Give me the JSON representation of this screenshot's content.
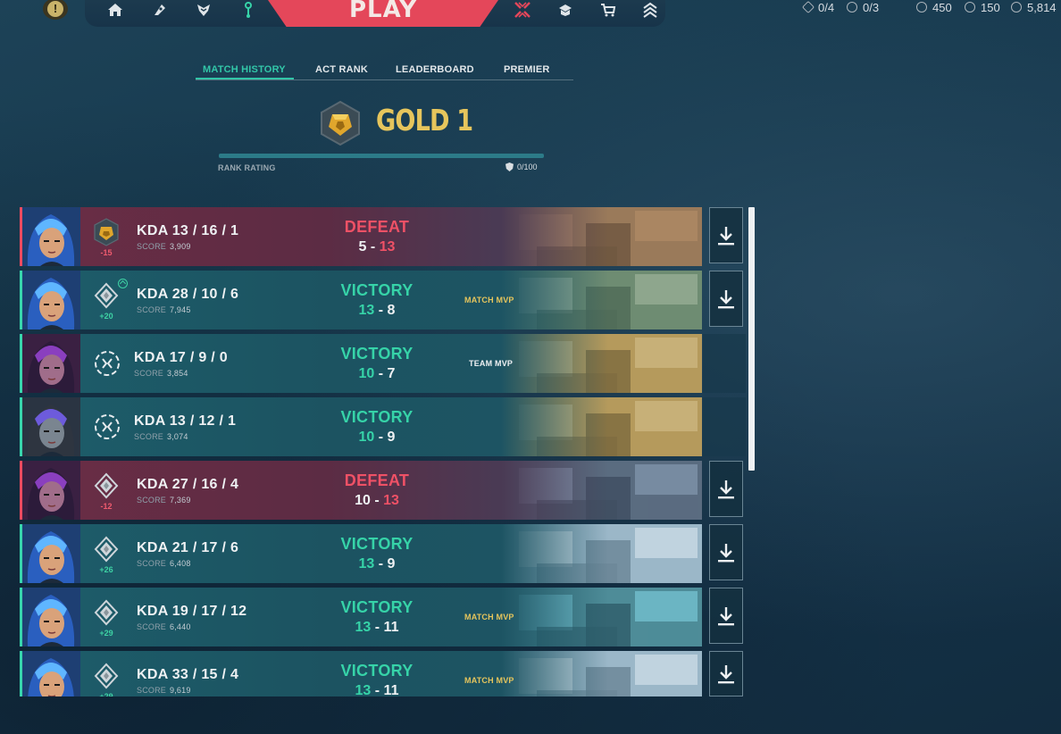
{
  "topbar": {
    "play_label": "PLAY",
    "nav_icons": [
      "home-icon",
      "battlepass-icon",
      "agents-icon",
      "career-icon",
      "crosshair-icon",
      "collection-icon",
      "store-icon",
      "rank-icon"
    ],
    "currencies": [
      {
        "icon": "kingdom-credits-icon",
        "value": "0/4"
      },
      {
        "icon": "free-agent-icon",
        "value": "0/3"
      },
      {
        "icon": "valorant-points-icon",
        "value": "450"
      },
      {
        "icon": "radianite-icon",
        "value": "150"
      },
      {
        "icon": "kingdom-points-icon",
        "value": "5,814"
      }
    ]
  },
  "tabs": [
    {
      "label": "MATCH HISTORY",
      "active": true
    },
    {
      "label": "ACT RANK",
      "active": false
    },
    {
      "label": "LEADERBOARD",
      "active": false
    },
    {
      "label": "PREMIER",
      "active": false
    }
  ],
  "rank": {
    "name": "GOLD 1",
    "rating_label": "RANK RATING",
    "rating_value": "0/100",
    "rating_fraction": 0
  },
  "matches": [
    {
      "result": "DEFEAT",
      "outcome": "loss",
      "kda": "KDA 13 / 16 / 1",
      "score_label": "SCORE",
      "score": "3,909",
      "rr": "-15",
      "rank_badge": "gold",
      "own": "5",
      "sep": " - ",
      "opp": "13",
      "mvp": "",
      "agent": "neon",
      "map": "Bind",
      "download": true
    },
    {
      "result": "VICTORY",
      "outcome": "win",
      "kda": "KDA 28 / 10 / 6",
      "score_label": "SCORE",
      "score": "7,945",
      "rr": "+20",
      "rank_badge": "silver",
      "rank_up": true,
      "own": "13",
      "sep": " - ",
      "opp": "8",
      "mvp": "MATCH MVP",
      "agent": "neon",
      "map": "Sunset",
      "download": true
    },
    {
      "result": "VICTORY",
      "outcome": "win",
      "kda": "KDA 17 / 9 / 0",
      "score_label": "SCORE",
      "score": "3,854",
      "rr": "",
      "rank_badge": "unrated",
      "own": "10",
      "sep": " - ",
      "opp": "7",
      "mvp": "TEAM MVP",
      "agent": "reyna",
      "map": "Ascent",
      "download": false
    },
    {
      "result": "VICTORY",
      "outcome": "win",
      "kda": "KDA 13 / 12 / 1",
      "score_label": "SCORE",
      "score": "3,074",
      "rr": "",
      "rank_badge": "unrated",
      "own": "10",
      "sep": " - ",
      "opp": "9",
      "mvp": "",
      "agent": "kayo",
      "map": "Ascent",
      "download": false
    },
    {
      "result": "DEFEAT",
      "outcome": "loss",
      "kda": "KDA 27 / 16 / 4",
      "score_label": "SCORE",
      "score": "7,369",
      "rr": "-12",
      "rank_badge": "silver",
      "own": "10",
      "sep": " - ",
      "opp": "13",
      "mvp": "",
      "agent": "reyna",
      "map": "Split",
      "download": true
    },
    {
      "result": "VICTORY",
      "outcome": "win",
      "kda": "KDA 21 / 17 / 6",
      "score_label": "SCORE",
      "score": "6,408",
      "rr": "+26",
      "rank_badge": "silver",
      "own": "13",
      "sep": " - ",
      "opp": "9",
      "mvp": "",
      "agent": "neon",
      "map": "Icebox",
      "download": true
    },
    {
      "result": "VICTORY",
      "outcome": "win",
      "kda": "KDA 19 / 17 / 12",
      "score_label": "SCORE",
      "score": "6,440",
      "rr": "+29",
      "rank_badge": "silver",
      "own": "13",
      "sep": " - ",
      "opp": "11",
      "mvp": "MATCH MVP",
      "agent": "neon",
      "map": "Lotus",
      "download": true
    },
    {
      "result": "VICTORY",
      "outcome": "win",
      "kda": "KDA 33 / 15 / 4",
      "score_label": "SCORE",
      "score": "9,619",
      "rr": "+29",
      "rank_badge": "silver",
      "own": "13",
      "sep": " - ",
      "opp": "11",
      "mvp": "MATCH MVP",
      "agent": "neon",
      "map": "Icebox",
      "download": true
    }
  ],
  "colors": {
    "accent": "#32c6a8",
    "win": "#36d3a8",
    "loss": "#ef5166",
    "gold": "#e6c55c",
    "play": "#e4475a"
  }
}
